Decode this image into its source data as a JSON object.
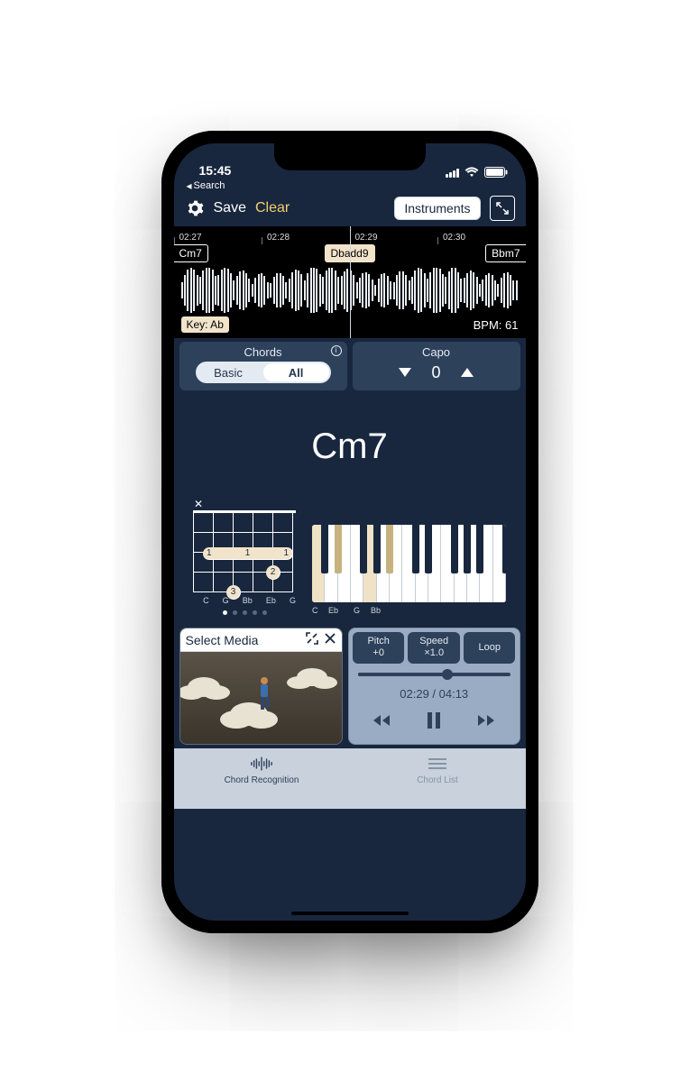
{
  "status": {
    "time": "15:45"
  },
  "back": {
    "label": "Search"
  },
  "toolbar": {
    "save": "Save",
    "clear": "Clear",
    "instruments": "Instruments"
  },
  "timeline": {
    "ticks": [
      "02:27",
      "02:28",
      "02:29",
      "02:30"
    ],
    "chords": {
      "left": "Cm7",
      "current": "Dbadd9",
      "right": "Bbm7"
    },
    "key_label": "Key: Ab",
    "bpm_label": "BPM: 61"
  },
  "controls": {
    "chords_title": "Chords",
    "seg_basic": "Basic",
    "seg_all": "All",
    "capo_title": "Capo",
    "capo_value": "0"
  },
  "main": {
    "chord_name": "Cm7",
    "guitar_notes": [
      "C",
      "G",
      "Bb",
      "Eb",
      "G"
    ],
    "piano_notes": [
      "C",
      "Eb",
      "G",
      "Bb"
    ],
    "fret1": "1",
    "fret1b": "1",
    "fret1c": "1",
    "finger2": "2",
    "finger3": "3"
  },
  "media": {
    "select_media": "Select Media"
  },
  "player": {
    "pitch_label": "Pitch",
    "pitch_value": "+0",
    "speed_label": "Speed",
    "speed_value": "×1.0",
    "loop_label": "Loop",
    "time": "02:29 / 04:13",
    "progress_pct": 59
  },
  "tabs": {
    "chord_rec": "Chord Recognition",
    "chord_list": "Chord List"
  }
}
